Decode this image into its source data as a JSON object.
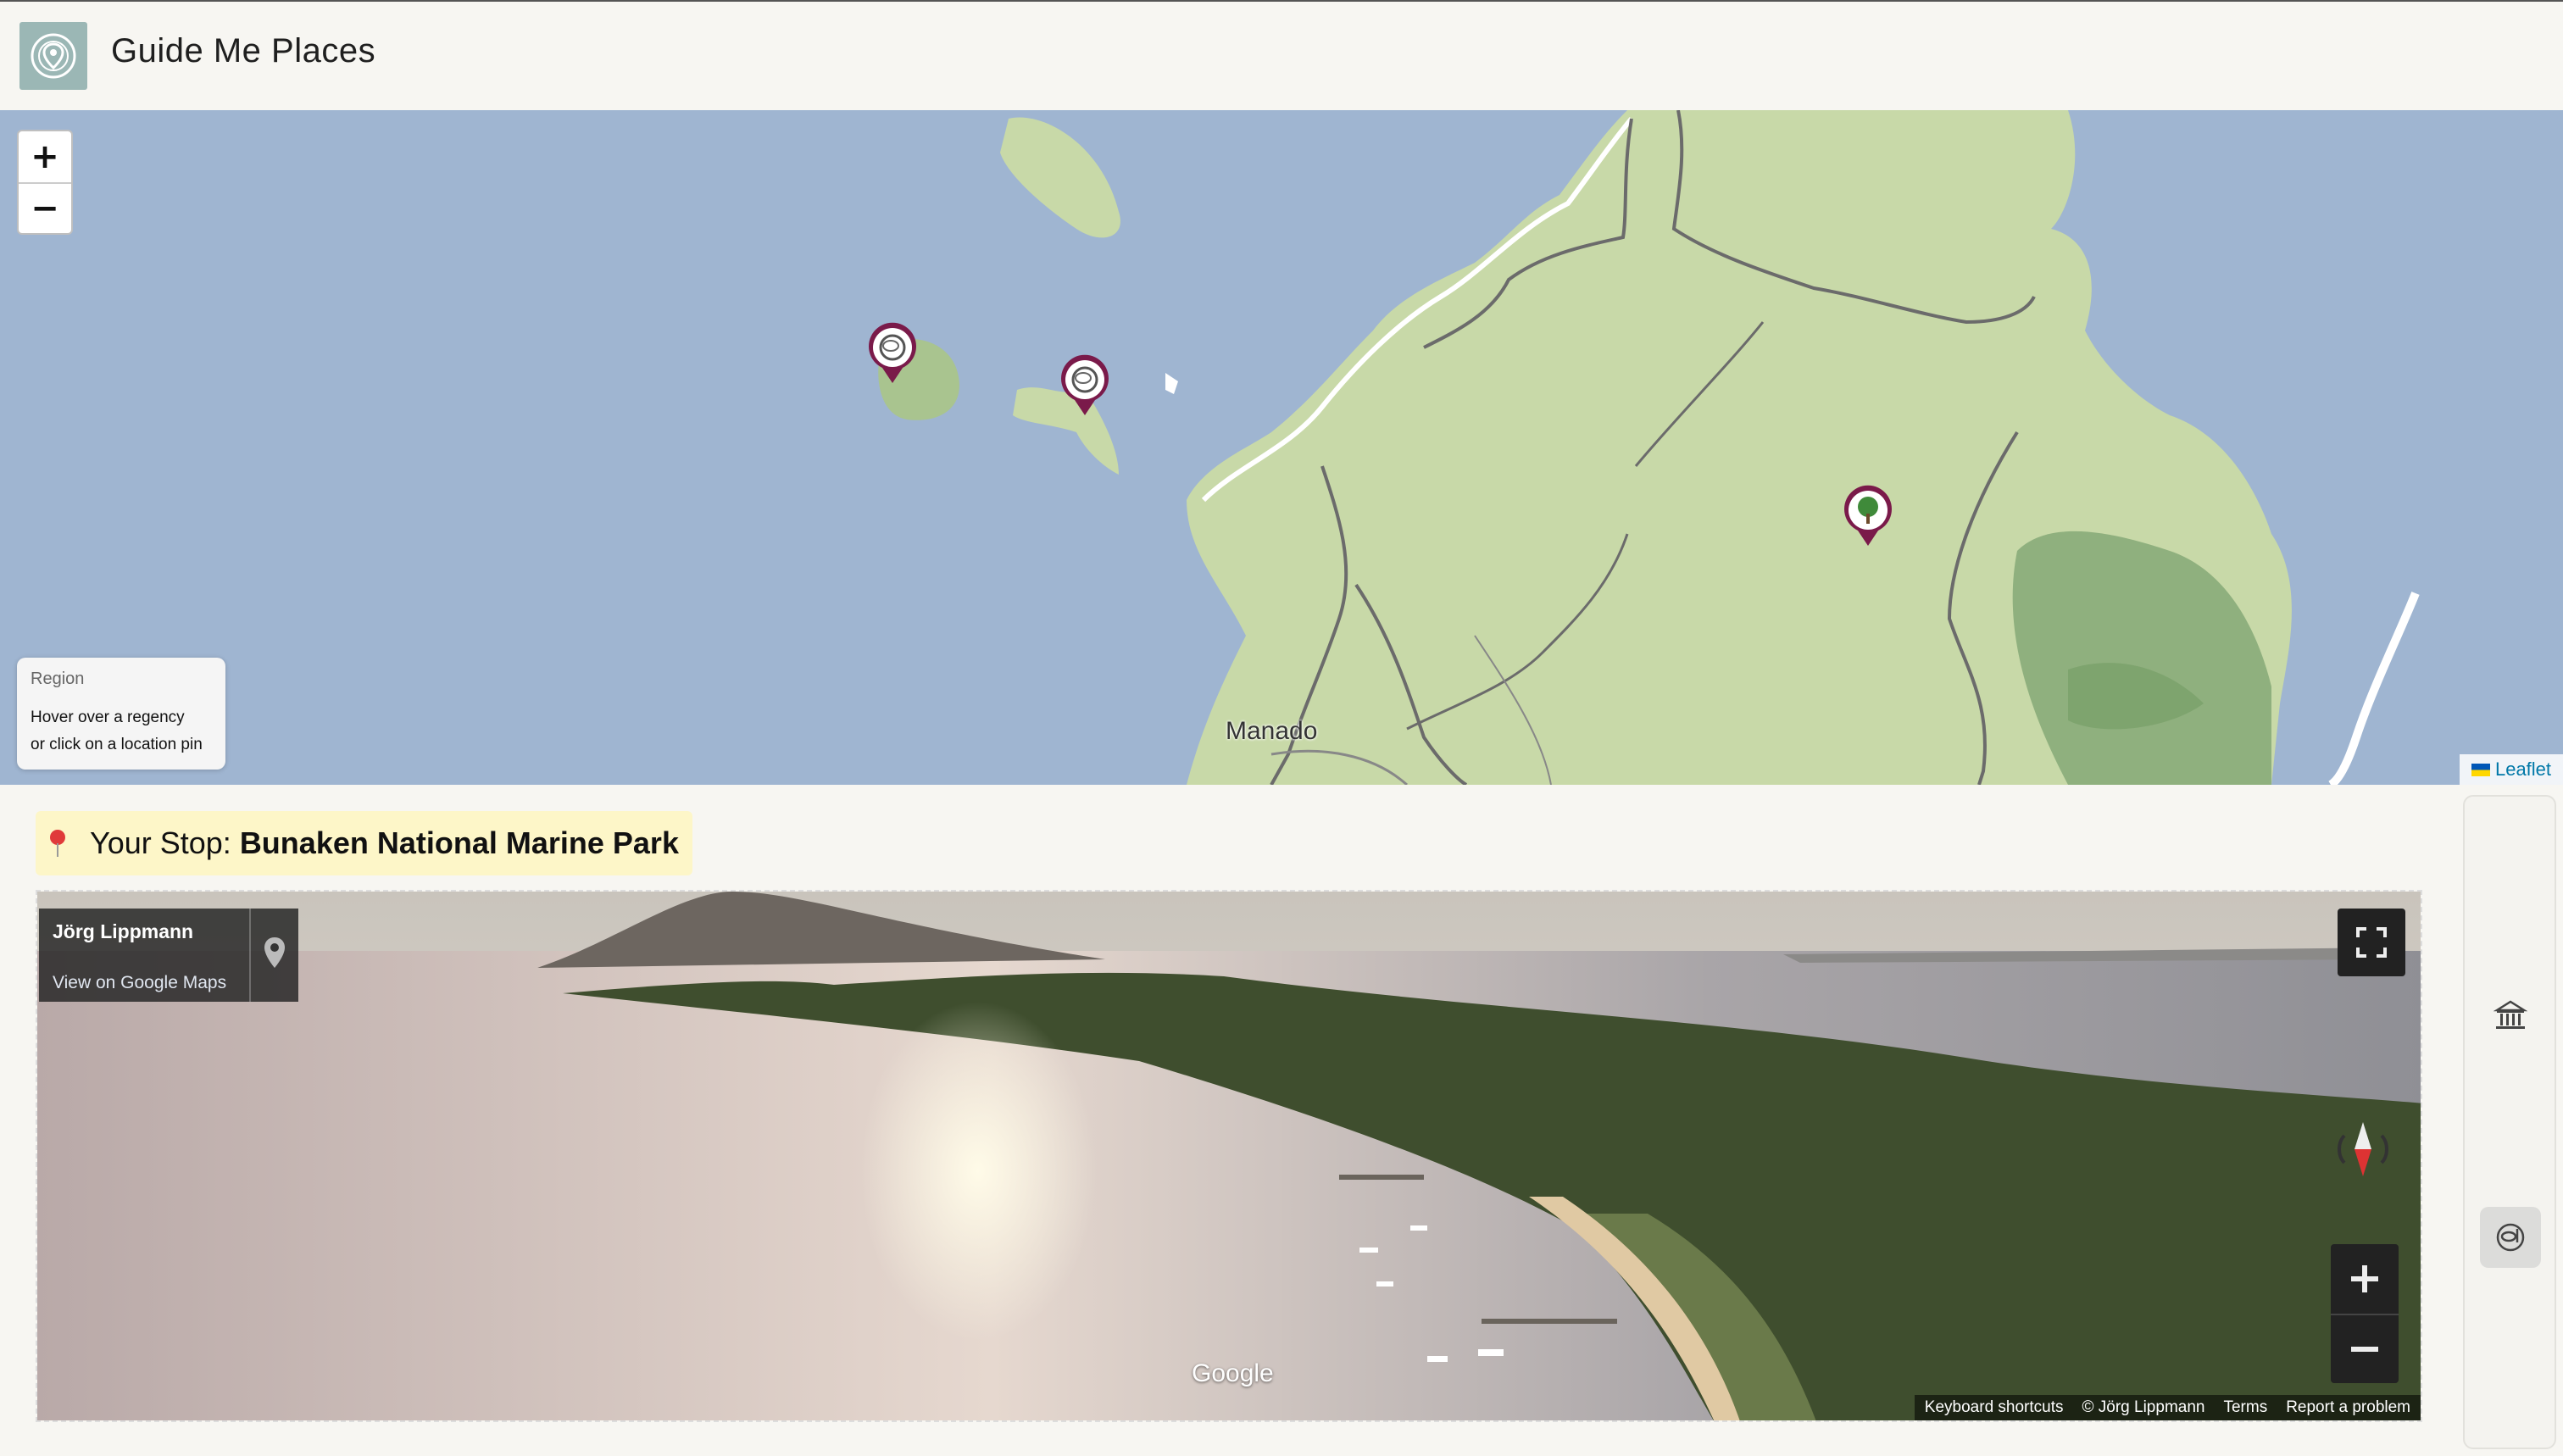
{
  "app": {
    "title": "Guide Me Places"
  },
  "map": {
    "zoom_in": "+",
    "zoom_out": "−",
    "region_box": {
      "title": "Region",
      "hint_line1": "Hover over a regency",
      "hint_line2": "or click on a location pin"
    },
    "city": "Manado",
    "attribution": "Leaflet",
    "pins": [
      {
        "category": "snorkel-icon",
        "color": "#7a1a4a"
      },
      {
        "category": "snorkel-icon",
        "color": "#7a1a4a"
      },
      {
        "category": "tree-icon",
        "color": "#7a1a4a"
      }
    ],
    "colors": {
      "water": "#9fb5d1",
      "land": "#c8d9a8",
      "forest": "#8fb07e",
      "border": "#6b6b6b"
    }
  },
  "stop": {
    "label": "Your Stop:",
    "name": "Bunaken National Marine Park"
  },
  "street_view": {
    "owner_name": "Jörg Lippmann",
    "owner_link": "View on Google Maps",
    "logo": "Google",
    "footer": {
      "shortcuts": "Keyboard shortcuts",
      "copyright": "© Jörg Lippmann",
      "terms": "Terms",
      "report": "Report a problem"
    }
  },
  "rail": {
    "icons": [
      "museum-icon",
      "snorkel-icon"
    ],
    "active": "snorkel-icon"
  }
}
